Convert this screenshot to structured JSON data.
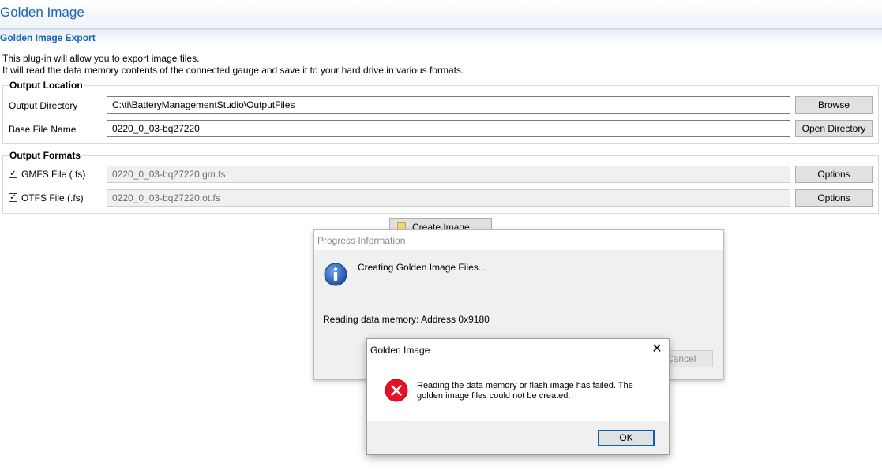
{
  "app": {
    "title": "Golden Image"
  },
  "section": {
    "title": "Golden Image Export",
    "description_line1": "This plug-in will allow you to export image files.",
    "description_line2": "It will read the data memory contents of the connected gauge and save it to your hard drive in various formats."
  },
  "output_location": {
    "title": "Output Location",
    "dir_label": "Output Directory",
    "dir_value": "C:\\ti\\BatteryManagementStudio\\OutputFiles",
    "browse_label": "Browse",
    "base_label": "Base File Name",
    "base_value": "0220_0_03-bq27220",
    "open_dir_label": "Open Directory"
  },
  "output_formats": {
    "title": "Output Formats",
    "items": [
      {
        "label": "GMFS File (.fs)",
        "checked": true,
        "value": "0220_0_03-bq27220.gm.fs",
        "options_label": "Options"
      },
      {
        "label": "OTFS File (.fs)",
        "checked": true,
        "value": "0220_0_03-bq27220.ot.fs",
        "options_label": "Options"
      }
    ]
  },
  "create_button_label": "Create Image Files",
  "progress_dialog": {
    "title": "Progress Information",
    "heading": "Creating Golden Image Files...",
    "status": "Reading data memory: Address 0x9180",
    "cancel_label": "Cancel"
  },
  "error_dialog": {
    "title": "Golden Image",
    "close_glyph": "✕",
    "message": "Reading the data memory or flash image has failed. The golden image files could not be created.",
    "ok_label": "OK"
  },
  "colors": {
    "accent": "#1b63b3",
    "error": "#e81123",
    "info": "#1f4fa8"
  }
}
